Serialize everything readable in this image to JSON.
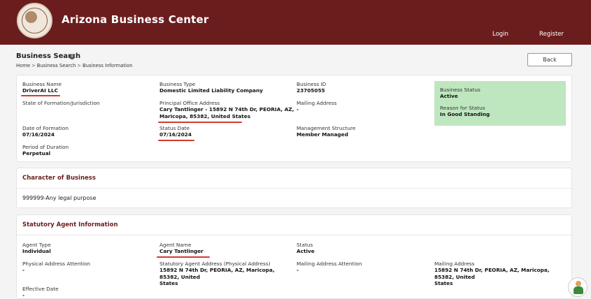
{
  "header": {
    "site_title": "Arizona Business Center",
    "nav": {
      "login": "Login",
      "register": "Register"
    },
    "brand_color": "#6b1d1d"
  },
  "page": {
    "heading": "Business Search",
    "breadcrumb": [
      "Home",
      "Business Search",
      "Business Information"
    ],
    "breadcrumb_sep": ">",
    "back_label": "Back"
  },
  "business": {
    "name_label": "Business Name",
    "name_value": "DriverAI LLC",
    "state_label": "State of Formation/Jurisdiction",
    "formation_label": "Date of Formation",
    "formation_value": "07/16/2024",
    "duration_label": "Period of Duration",
    "duration_value": "Perpetual",
    "type_label": "Business Type",
    "type_value": "Domestic Limited Liability Company",
    "principal_label": "Principal Office Address",
    "principal_value_line1": "Cary Tantlinger - 15892 N 74th Dr, PEORIA, AZ,",
    "principal_value_line2": "Maricopa, 85382, United States",
    "status_date_label": "Status Date",
    "status_date_value": "07/16/2024",
    "id_label": "Business ID",
    "id_value": "23705055",
    "mailing_label": "Mailing Address",
    "mailing_value": "-",
    "mgmt_label": "Management Structure",
    "mgmt_value": "Member Managed",
    "status_label": "Business Status",
    "status_value": "Active",
    "reason_label": "Reason for Status",
    "reason_value": "In Good Standing",
    "status_color": "#bfe7bf"
  },
  "character": {
    "title": "Character of Business",
    "value": "999999-Any legal purpose"
  },
  "agent": {
    "title": "Statutory Agent Information",
    "type_label": "Agent Type",
    "type_value": "Individual",
    "physical_attn_label": "Physical Address Attention",
    "physical_attn_value": "-",
    "effective_label": "Effective Date",
    "effective_value": "-",
    "name_label": "Agent Name",
    "name_value": "Cary Tantlinger",
    "address_label": "Statutory Agent Address (Physical Address)",
    "address_line1": "15892 N 74th Dr, PEORIA, AZ, Maricopa, 85382, United",
    "address_line2": "States",
    "status_label": "Status",
    "status_value": "Active",
    "mailing_attn_label": "Mailing Address Attention",
    "mailing_attn_value": "-",
    "mailing_label": "Mailing Address",
    "mailing_line1": "15892 N 74th Dr, PEORIA, AZ, Maricopa, 85382, United",
    "mailing_line2": "States"
  },
  "icons": {
    "seal": "state-seal-icon",
    "info": "info-icon",
    "helper": "assistant-avatar-icon"
  }
}
